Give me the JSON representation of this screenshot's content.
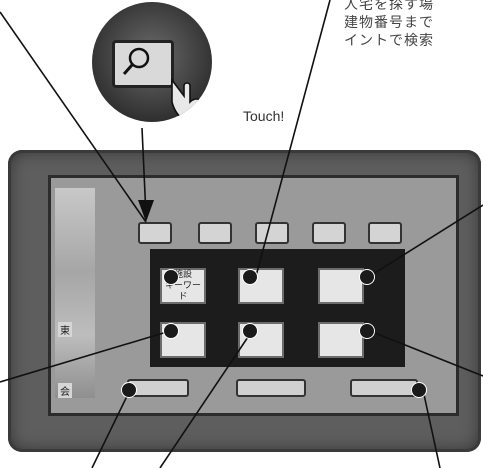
{
  "description": {
    "lines": [
      "人宅を探す場",
      "建物番号まで",
      "イントで検索"
    ]
  },
  "callout": {
    "touch_label": "Touch!"
  },
  "screen": {
    "map_labels": [
      "会",
      "東"
    ],
    "tabs": [
      "",
      "",
      "",
      "",
      ""
    ],
    "menu_buttons": [
      {
        "line1": "施設",
        "line2": "キーワード"
      },
      {
        "line1": "",
        "line2": ""
      },
      {
        "line1": "",
        "line2": ""
      },
      {
        "line1": "",
        "line2": ""
      },
      {
        "line1": "",
        "line2": ""
      },
      {
        "line1": "",
        "line2": ""
      }
    ],
    "bottom_buttons": [
      "",
      "",
      ""
    ]
  }
}
